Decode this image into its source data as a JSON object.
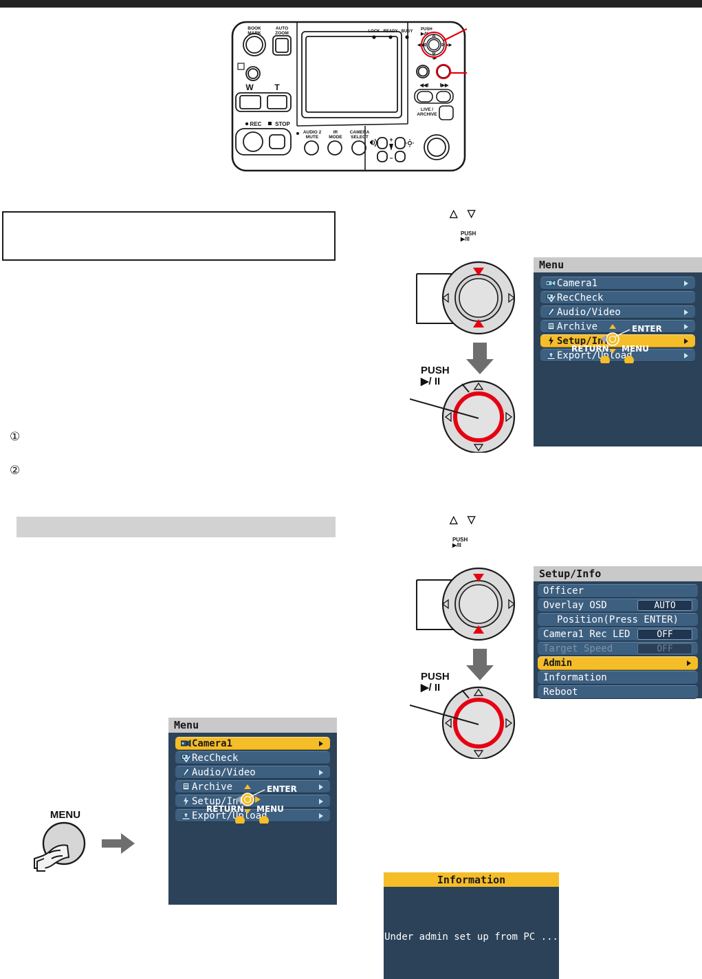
{
  "page": {
    "background": "#ffffff",
    "top_bar_color": "#232323"
  },
  "device": {
    "name": "controller-unit",
    "labels": {
      "book_mark": "BOOK\nMARK",
      "auto_zoom": "AUTO\nZOOM",
      "wide": "W",
      "tele": "T",
      "rec": "REC",
      "stop": "STOP",
      "audio2_mute": "AUDIO 2\nMUTE",
      "ir_mode": "IR\nMODE",
      "camera_select": "CAMERA\nSELECT",
      "lock": "LOCK",
      "ready": "READY",
      "busy": "BUSY",
      "push_play_pause": "PUSH\n▶/II",
      "live_archive": "LIVE /\nARCHIVE",
      "plus": "+",
      "minus": "−"
    },
    "callout_color": "#e60012"
  },
  "steps": {
    "number_1": "①",
    "number_2": "②"
  },
  "dial_diagrams": [
    {
      "name": "dial-diagram-menu",
      "top_glyphs": "△  ▽",
      "push_caption": "PUSH\n▶/II",
      "push_label": "PUSH\n▶/ II",
      "arrow_color": "#e60012",
      "down_arrow_color": "#6e6e6e"
    },
    {
      "name": "dial-diagram-setup",
      "top_glyphs": "△  ▽",
      "push_caption": "PUSH\n▶/II",
      "push_label": "PUSH\n▶/ II",
      "arrow_color": "#e60012",
      "down_arrow_color": "#6e6e6e"
    }
  ],
  "menu_osd": {
    "title": "Menu",
    "items": [
      {
        "label": "Camera1",
        "icon": "camera-icon",
        "arrow": true,
        "selected": false
      },
      {
        "label": "RecCheck",
        "icon": "reccheck-icon",
        "arrow": false,
        "selected": false
      },
      {
        "label": "Audio/Video",
        "icon": "mic-icon",
        "arrow": true,
        "selected": false
      },
      {
        "label": "Archive",
        "icon": "archive-icon",
        "arrow": true,
        "selected": false
      },
      {
        "label": "Setup/Info",
        "icon": "plug-icon",
        "arrow": true,
        "selected": true
      },
      {
        "label": "Export/Upload",
        "icon": "upload-icon",
        "arrow": true,
        "selected": false
      }
    ],
    "legend": {
      "enter": "ENTER",
      "return": "RETURN",
      "menu": "MENU"
    }
  },
  "menu_osd_bottom": {
    "title": "Menu",
    "items": [
      {
        "label": "Camera1",
        "icon": "camera-icon",
        "arrow": true,
        "selected": true
      },
      {
        "label": "RecCheck",
        "icon": "reccheck-icon",
        "arrow": false,
        "selected": false
      },
      {
        "label": "Audio/Video",
        "icon": "mic-icon",
        "arrow": true,
        "selected": false
      },
      {
        "label": "Archive",
        "icon": "archive-icon",
        "arrow": true,
        "selected": false
      },
      {
        "label": "Setup/Info",
        "icon": "plug-icon",
        "arrow": true,
        "selected": false
      },
      {
        "label": "Export/Upload",
        "icon": "upload-icon",
        "arrow": true,
        "selected": false
      }
    ],
    "legend": {
      "enter": "ENTER",
      "return": "RETURN",
      "menu": "MENU"
    }
  },
  "setup_osd": {
    "title": "Setup/Info",
    "items": [
      {
        "label": "Officer",
        "value": null,
        "arrow": false,
        "selected": false,
        "disabled": false,
        "centered": false
      },
      {
        "label": "Overlay OSD",
        "value": "AUTO",
        "arrow": false,
        "selected": false,
        "disabled": false,
        "centered": false
      },
      {
        "label": "Position(Press ENTER)",
        "value": null,
        "arrow": false,
        "selected": false,
        "disabled": false,
        "centered": true
      },
      {
        "label": "Camera1 Rec LED",
        "value": "OFF",
        "arrow": false,
        "selected": false,
        "disabled": false,
        "centered": false
      },
      {
        "label": "Target Speed",
        "value": "OFF",
        "arrow": false,
        "selected": false,
        "disabled": true,
        "centered": false
      },
      {
        "label": "Admin",
        "value": null,
        "arrow": true,
        "selected": true,
        "disabled": false,
        "centered": false
      },
      {
        "label": "Information",
        "value": null,
        "arrow": false,
        "selected": false,
        "disabled": false,
        "centered": false
      },
      {
        "label": "Reboot",
        "value": null,
        "arrow": false,
        "selected": false,
        "disabled": false,
        "centered": false
      }
    ]
  },
  "info_dialog": {
    "title": "Information",
    "message": "Under admin set up from PC ..."
  },
  "menu_button_figure": {
    "label": "MENU"
  },
  "colors": {
    "osd_background": "#2c4259",
    "osd_row": "#3d5f80",
    "osd_selected": "#f5bd28",
    "osd_title_bar": "#c9c9c9",
    "section_bar": "#d2d2d2",
    "callout_red": "#e60012",
    "arrow_gray": "#6e6e6e"
  }
}
